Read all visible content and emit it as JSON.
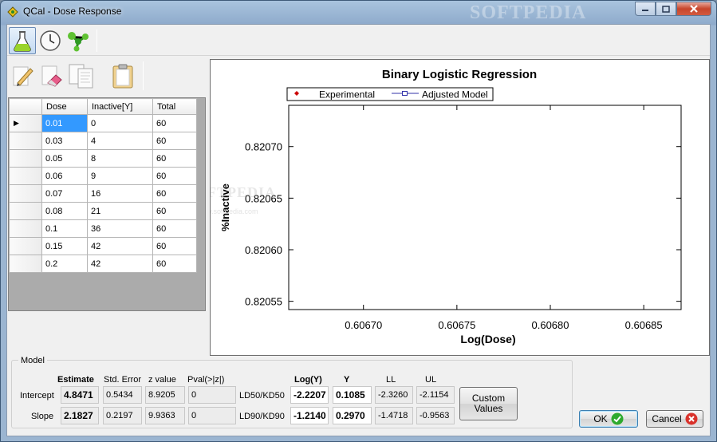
{
  "window": {
    "title": "QCal - Dose Response",
    "watermark": "SOFTPEDIA"
  },
  "toolbar": {
    "icons": [
      "flask-icon",
      "clock-icon",
      "molecule-icon"
    ]
  },
  "edit_toolbar": {
    "icons": [
      "pencil-icon",
      "eraser-icon",
      "copy-icon",
      "paste-icon"
    ]
  },
  "grid": {
    "columns": [
      "Dose",
      "Inactive[Y]",
      "Total"
    ],
    "rows": [
      [
        "0.01",
        "0",
        "60"
      ],
      [
        "0.03",
        "4",
        "60"
      ],
      [
        "0.05",
        "8",
        "60"
      ],
      [
        "0.06",
        "9",
        "60"
      ],
      [
        "0.07",
        "16",
        "60"
      ],
      [
        "0.08",
        "21",
        "60"
      ],
      [
        "0.1",
        "36",
        "60"
      ],
      [
        "0.15",
        "42",
        "60"
      ],
      [
        "0.2",
        "42",
        "60"
      ]
    ],
    "current_row_marker": "▶"
  },
  "chart_data": {
    "type": "scatter",
    "title": "Binary Logistic Regression",
    "xlabel": "Log(Dose)",
    "ylabel": "%Inactive",
    "xlim": [
      0.60666,
      0.60687
    ],
    "ylim": [
      0.820542,
      0.82074
    ],
    "x_ticks": [
      "0.60670",
      "0.60675",
      "0.60680",
      "0.60685"
    ],
    "x_tick_values": [
      0.6067,
      0.60675,
      0.6068,
      0.60685
    ],
    "y_ticks": [
      "0.82070",
      "0.82065",
      "0.82060",
      "0.82055"
    ],
    "y_tick_values": [
      0.8207,
      0.82065,
      0.8206,
      0.82055
    ],
    "legend": {
      "placement": "top-center",
      "entries": [
        {
          "name": "Experimental",
          "marker": "diamond",
          "color": "#cc0000"
        },
        {
          "name": "Adjusted Model",
          "marker": "square-line",
          "color": "#3333aa"
        }
      ]
    },
    "series": [],
    "watermark_text": "SOFTPEDIA",
    "watermark_sub": "www.softpedia.com"
  },
  "model": {
    "group_label": "Model",
    "headers": {
      "estimate": "Estimate",
      "std_error": "Std. Error",
      "z_value": "z value",
      "pval": "Pval(>|z|)",
      "logy": "Log(Y)",
      "y": "Y",
      "ll": "LL",
      "ul": "UL"
    },
    "intercept": {
      "label": "Intercept",
      "estimate": "4.8471",
      "std_error": "0.5434",
      "z_value": "8.9205",
      "pval": "0"
    },
    "slope": {
      "label": "Slope",
      "estimate": "2.1827",
      "std_error": "0.2197",
      "z_value": "9.9363",
      "pval": "0"
    },
    "ld50": {
      "label": "LD50/KD50",
      "logy": "-2.2207",
      "y": "0.1085",
      "ll": "-2.3260",
      "ul": "-2.1154"
    },
    "ld90": {
      "label": "LD90/KD90",
      "logy": "-1.2140",
      "y": "0.2970",
      "ll": "-1.4718",
      "ul": "-0.9563"
    },
    "custom_values_label": "Custom Values"
  },
  "buttons": {
    "ok": "OK",
    "cancel": "Cancel"
  },
  "colors": {
    "ok_check": "#2eaa2e",
    "cancel_x": "#d9322b",
    "selection": "#3399ff"
  }
}
